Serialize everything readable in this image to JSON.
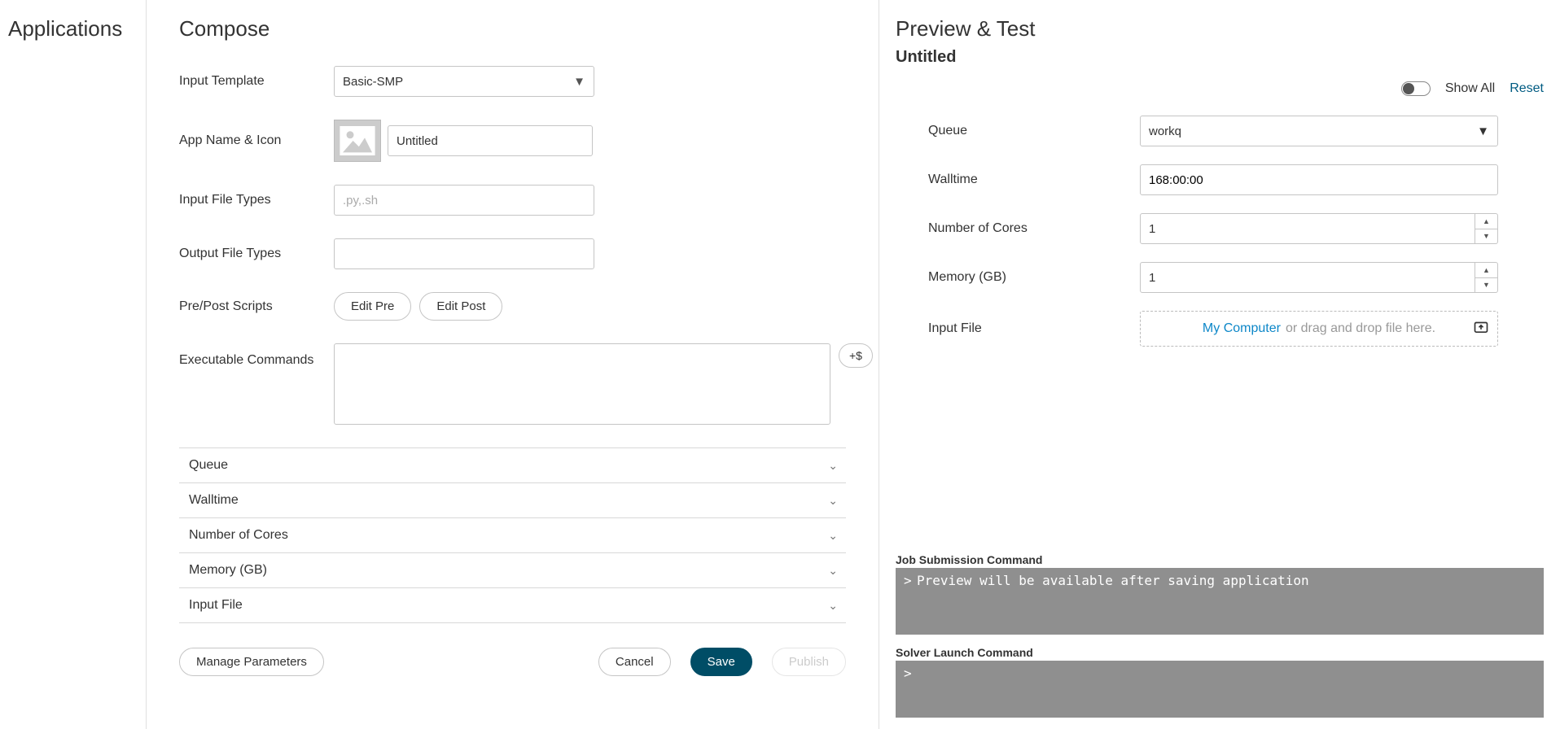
{
  "sidebar": {
    "title": "Applications"
  },
  "compose": {
    "title": "Compose",
    "labels": {
      "input_template": "Input Template",
      "app_name_icon": "App Name & Icon",
      "input_file_types": "Input File Types",
      "output_file_types": "Output File Types",
      "pre_post": "Pre/Post Scripts",
      "exec_commands": "Executable Commands"
    },
    "input_template_value": "Basic-SMP",
    "app_name_value": "Untitled",
    "input_file_types_placeholder": ".py,.sh",
    "output_file_types_value": "",
    "edit_pre": "Edit Pre",
    "edit_post": "Edit Post",
    "exec_commands_value": "",
    "add_var": "+$",
    "accordion": [
      "Queue",
      "Walltime",
      "Number of Cores",
      "Memory (GB)",
      "Input File"
    ],
    "manage_params": "Manage Parameters",
    "cancel": "Cancel",
    "save": "Save",
    "publish": "Publish"
  },
  "preview": {
    "title": "Preview & Test",
    "subtitle": "Untitled",
    "show_all": "Show All",
    "reset": "Reset",
    "labels": {
      "queue": "Queue",
      "walltime": "Walltime",
      "cores": "Number of Cores",
      "memory": "Memory (GB)",
      "input_file": "Input File"
    },
    "queue_value": "workq",
    "walltime_value": "168:00:00",
    "cores_value": "1",
    "memory_value": "1",
    "my_computer": "My Computer",
    "drop_text": "or drag and drop file here.",
    "job_cmd_label": "Job Submission Command",
    "job_cmd_text": "Preview will be available after saving application",
    "solver_cmd_label": "Solver Launch Command",
    "solver_cmd_text": ""
  }
}
